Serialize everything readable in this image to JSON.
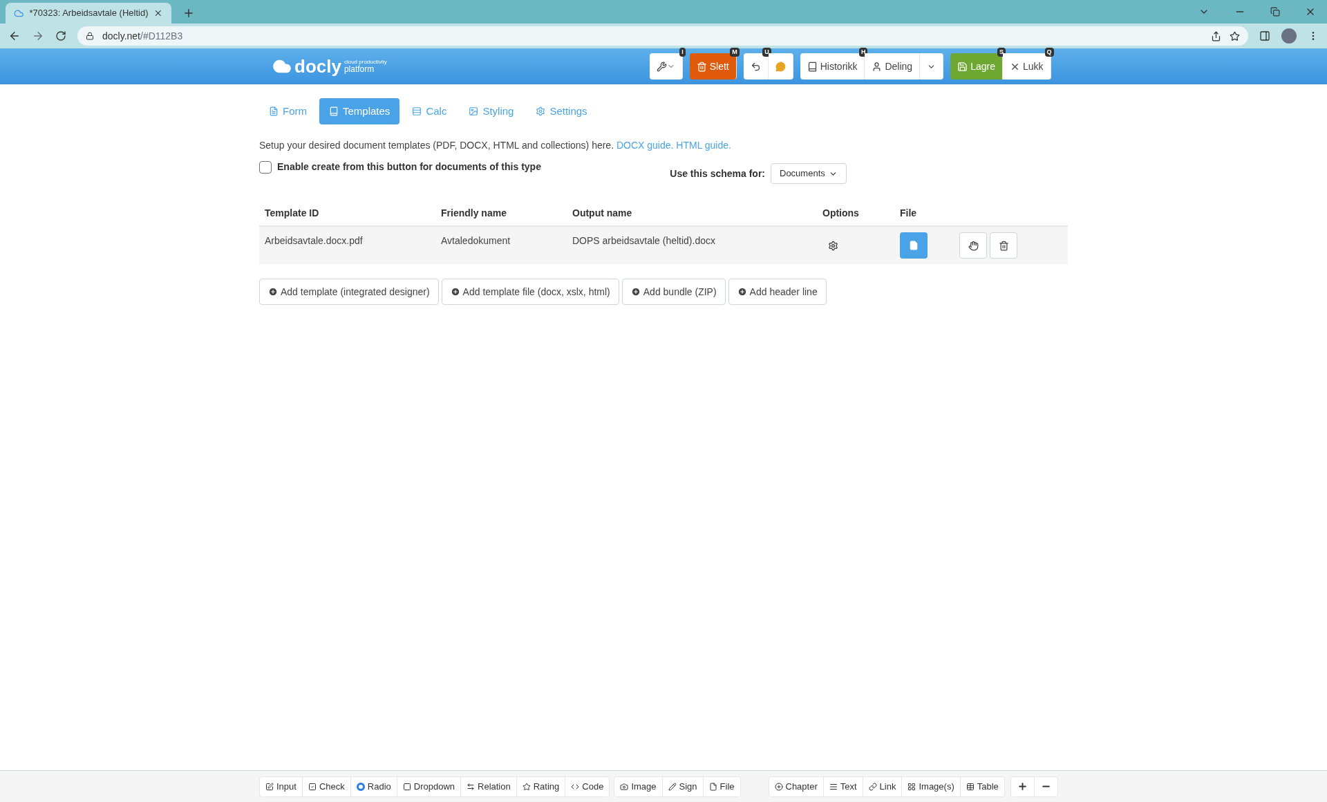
{
  "browser": {
    "tab_title": "*70323: Arbeidsavtale (Heltid)",
    "url_host": "docly.net",
    "url_path": "/#D112B3"
  },
  "logo": {
    "name": "docly",
    "tagline": "cloud productivity",
    "sub": "platform"
  },
  "toolbar": [
    {
      "buttons": [
        {
          "kind": "tools",
          "badge": "I"
        }
      ]
    },
    {
      "buttons": [
        {
          "kind": "danger",
          "label": "Slett",
          "badge": "M"
        }
      ]
    },
    {
      "buttons": [
        {
          "kind": "undo",
          "badge": "U"
        },
        {
          "kind": "comment"
        }
      ]
    },
    {
      "buttons": [
        {
          "kind": "history",
          "label": "Historikk",
          "badge": "H"
        },
        {
          "kind": "share",
          "label": "Deling"
        },
        {
          "kind": "caret"
        }
      ]
    },
    {
      "buttons": [
        {
          "kind": "success",
          "label": "Lagre",
          "badge": "S"
        },
        {
          "kind": "close",
          "label": "Lukk",
          "badge": "Q"
        }
      ]
    }
  ],
  "tabs": [
    {
      "label": "Form",
      "selected": false
    },
    {
      "label": "Templates",
      "selected": true
    },
    {
      "label": "Calc",
      "selected": false
    },
    {
      "label": "Styling",
      "selected": false
    },
    {
      "label": "Settings",
      "selected": false
    }
  ],
  "intro": {
    "text": "Setup your desired document templates (PDF, DOCX, HTML and collections) here.",
    "links": [
      "DOCX guide.",
      "HTML guide."
    ]
  },
  "enable_checkbox": {
    "label": "Enable create from this button for documents of this type",
    "checked": false
  },
  "schema_select": {
    "label": "Use this schema for:",
    "value": "Documents"
  },
  "table": {
    "columns": [
      "Template ID",
      "Friendly name",
      "Output name",
      "Options",
      "File"
    ],
    "rows": [
      {
        "template_id": "Arbeidsavtale.docx.pdf",
        "friendly_name": "Avtaledokument",
        "output_name": "DOPS arbeidsavtale (heltid).docx"
      }
    ]
  },
  "add_buttons": [
    "Add template (integrated designer)",
    "Add template file (docx, xslx, html)",
    "Add bundle (ZIP)",
    "Add header line"
  ],
  "bottom_toolbar": [
    {
      "buttons": [
        "Input",
        "Check",
        "Radio",
        "Dropdown",
        "Relation",
        "Rating",
        "Code"
      ]
    },
    {
      "buttons": [
        "Image",
        "Sign",
        "File"
      ]
    },
    {
      "buttons": [
        "Chapter",
        "Text",
        "Link",
        "Image(s)",
        "Table"
      ]
    }
  ]
}
